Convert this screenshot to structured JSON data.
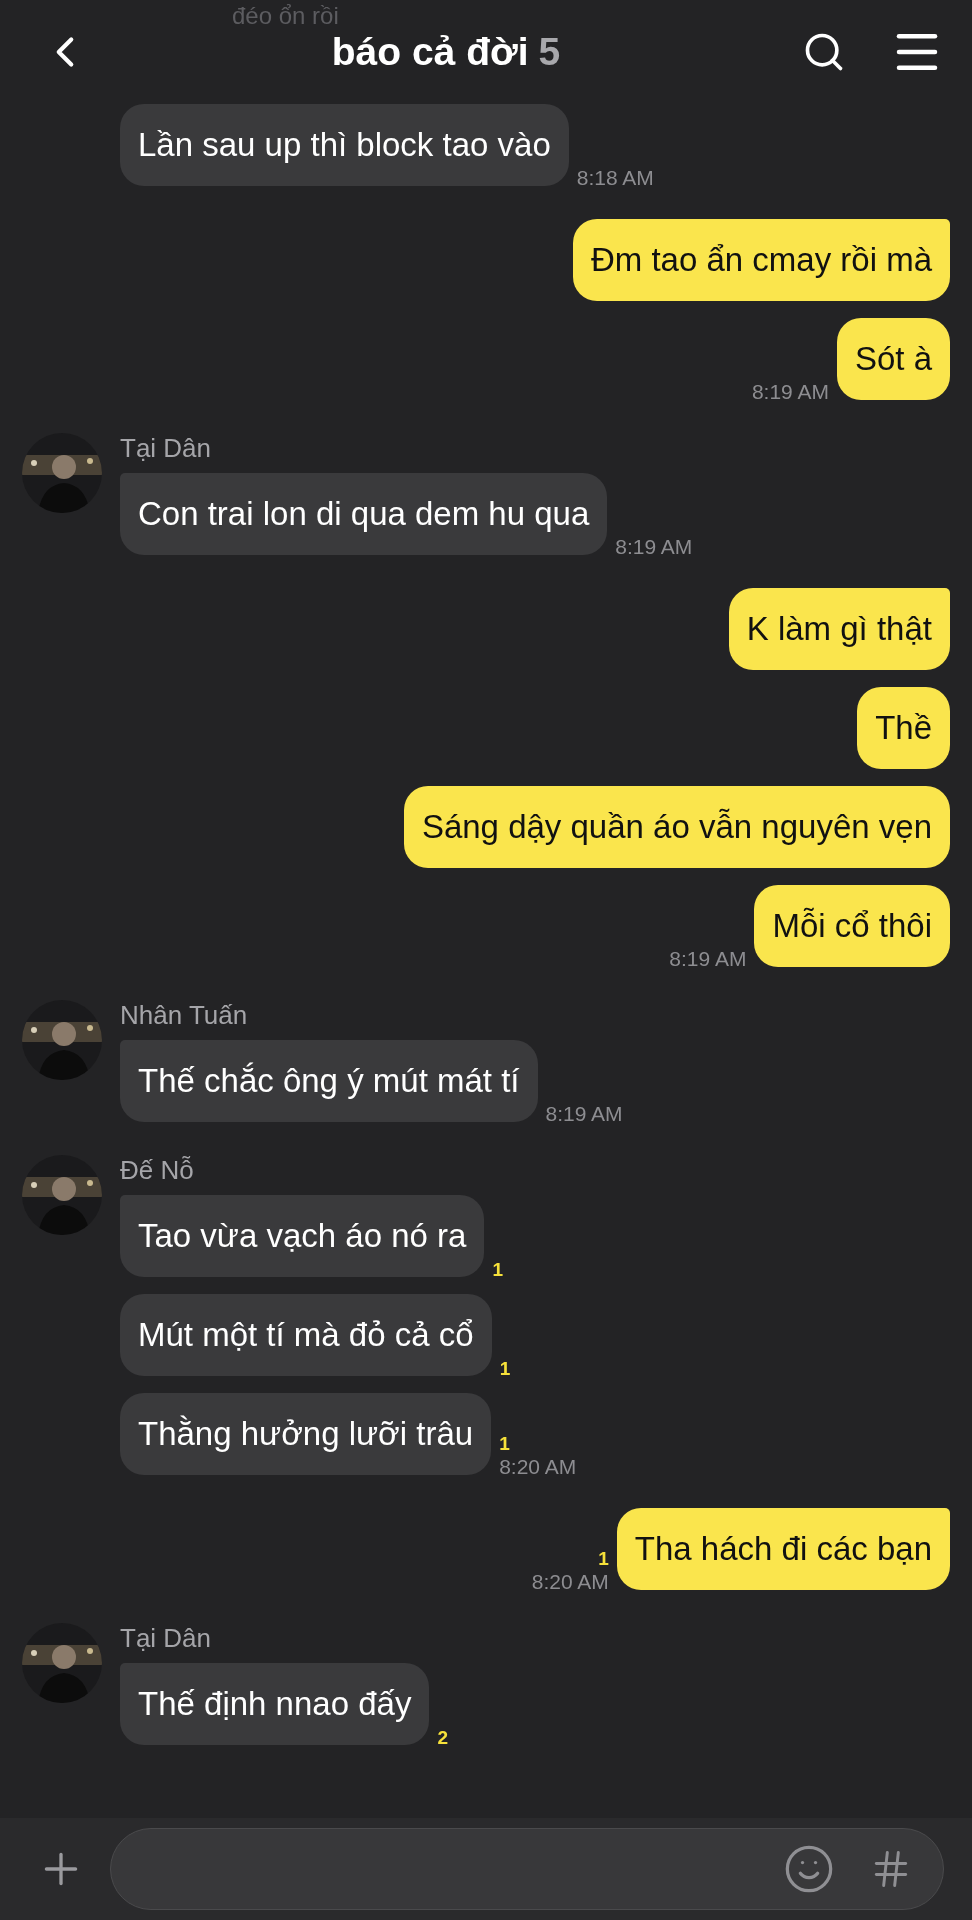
{
  "faded_notice": "đéo ổn rồi",
  "header": {
    "title": "báo cả đời",
    "member_count": "5"
  },
  "groups": [
    {
      "kind": "incoming",
      "messages": [
        {
          "text": "Lần sau up thì block tao vào",
          "time": "8:18 AM"
        }
      ]
    },
    {
      "kind": "outgoing",
      "messages": [
        {
          "text": "Đm tao ẩn cmay rồi mà"
        },
        {
          "text": "Sót à",
          "time": "8:19 AM"
        }
      ]
    },
    {
      "kind": "incoming",
      "sender": "Tại Dân",
      "messages": [
        {
          "text": "Con trai lon di qua dem hu qua",
          "time": "8:19 AM"
        }
      ]
    },
    {
      "kind": "outgoing",
      "messages": [
        {
          "text": "K làm gì thật"
        },
        {
          "text": "Thề"
        },
        {
          "text": "Sáng dậy quần áo vẫn nguyên vẹn"
        },
        {
          "text": "Mỗi cổ thôi",
          "time": "8:19 AM"
        }
      ]
    },
    {
      "kind": "incoming",
      "sender": "Nhân Tuấn",
      "messages": [
        {
          "text": "Thế chắc ông ý mút mát tí",
          "time": "8:19 AM"
        }
      ]
    },
    {
      "kind": "incoming",
      "sender": "Đế Nỗ",
      "messages": [
        {
          "text": "Tao vừa vạch áo nó ra",
          "unread": "1"
        },
        {
          "text": "Mút một tí mà đỏ cả cổ",
          "unread": "1"
        },
        {
          "text": "Thằng hưởng lưỡi trâu",
          "unread": "1",
          "time": "8:20 AM"
        }
      ]
    },
    {
      "kind": "outgoing",
      "messages": [
        {
          "text": "Tha hách đi các bạn",
          "unread": "1",
          "time": "8:20 AM"
        }
      ]
    },
    {
      "kind": "incoming",
      "sender": "Tại Dân",
      "messages": [
        {
          "text": "Thế định nnao đấy",
          "unread": "2"
        }
      ]
    }
  ]
}
